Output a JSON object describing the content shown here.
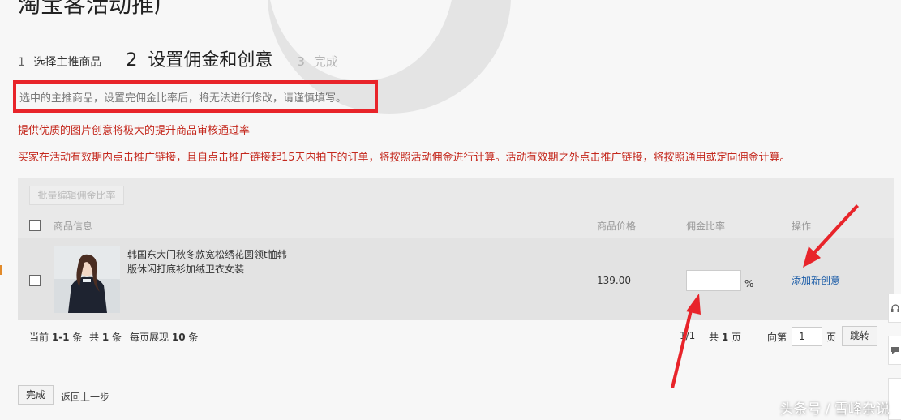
{
  "page": {
    "title": "淘宝客活动推广"
  },
  "steps": [
    {
      "num": "1",
      "label": "选择主推商品"
    },
    {
      "num": "2",
      "label": "设置佣金和创意"
    },
    {
      "num": "3",
      "label": "完成"
    }
  ],
  "notices": {
    "boxed": "选中的主推商品，设置完佣金比率后，将无法进行修改，请谨慎填写。",
    "tip1": "提供优质的图片创意将极大的提升商品审核通过率",
    "tip2": "买家在活动有效期内点击推广链接，且自点击推广链接起15天内拍下的订单，将按照活动佣金进行计算。活动有效期之外点击推广链接，将按照通用或定向佣金计算。"
  },
  "table": {
    "batch_button": "批量编辑佣金比率",
    "headers": {
      "product_info": "商品信息",
      "price": "商品价格",
      "commission_rate": "佣金比率",
      "actions": "操作"
    },
    "rows": [
      {
        "name": "韩国东大门秋冬款宽松绣花圆领t恤韩版休闲打底衫加绒卫衣女装",
        "price": "139.00",
        "commission_value": "",
        "percent": "%",
        "action": "添加新创意"
      }
    ]
  },
  "pager": {
    "current_prefix": "当前",
    "current_range": "1-1",
    "current_suffix": "条",
    "total_prefix": "共",
    "total_count": "1",
    "total_suffix": "条",
    "per_page_prefix": "每页展现",
    "per_page": "10",
    "per_page_suffix": "条",
    "page_of": "1/1",
    "total_pages_prefix": "共",
    "total_pages": "1",
    "total_pages_suffix": "页",
    "goto_prefix": "向第",
    "goto_value": "1",
    "goto_suffix": "页",
    "jump_button": "跳转"
  },
  "footer": {
    "finish_button": "完成",
    "back_link": "返回上一步"
  },
  "watermark": {
    "credit": "头条号 / 雪峰杂说"
  },
  "colors": {
    "highlight_box": "#e8242a",
    "red_text": "#c4281d",
    "link": "#1c5da8",
    "annotation_arrow": "#e8242a"
  },
  "icons": [
    "checkbox-icon",
    "arrow-annotation-icon",
    "product-thumbnail"
  ]
}
